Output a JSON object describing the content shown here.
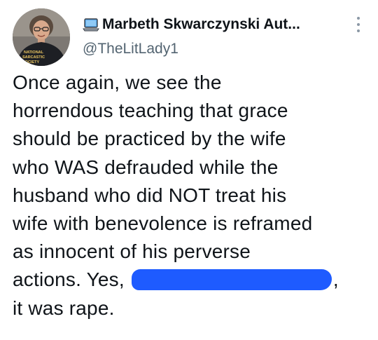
{
  "author": {
    "display_name": "Marbeth Skwarczynski Aut...",
    "handle": "@TheLitLady1",
    "badge_icon": "laptop-icon",
    "avatar_shirt_text": [
      "NATIONAL",
      "SARCASTIC",
      "SOCIETY"
    ]
  },
  "tweet": {
    "lines": [
      "Once again, we see the",
      "horrendous teaching that grace",
      "should be practiced by the wife",
      "who WAS defrauded while the",
      "husband who did NOT treat his",
      "wife with benevolence is reframed",
      "as innocent of his perverse"
    ],
    "line8_prefix": "actions. Yes,",
    "line8_suffix": ",",
    "line9": "it was rape."
  },
  "colors": {
    "text": "#0f1419",
    "secondary": "#536471",
    "redaction": "#1e5bff"
  }
}
